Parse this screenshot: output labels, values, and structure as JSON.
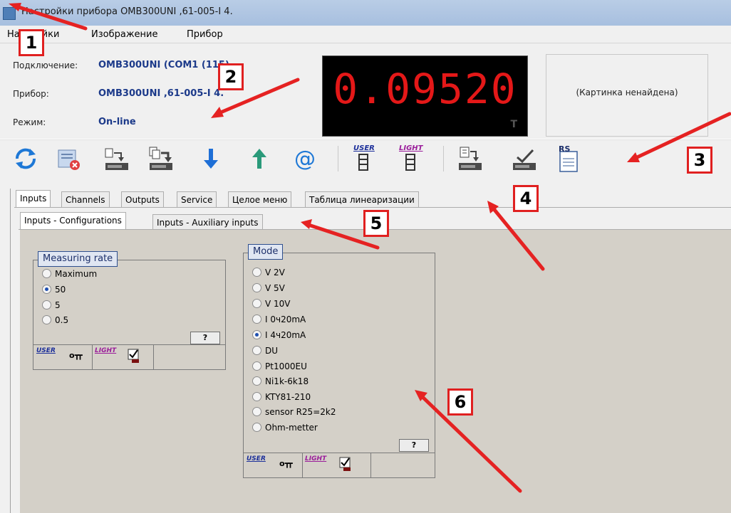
{
  "window": {
    "title": "Настройки прибора OMB300UNI  ,61-005-I 4."
  },
  "menu": {
    "items": [
      "Настройки",
      "Изображение",
      "Прибор"
    ]
  },
  "info": {
    "connection_label": "Подключение:",
    "connection_value": "OMB300UNI (COM1 (115)",
    "device_label": "Прибор:",
    "device_value": "OMB300UNI  ,61-005-I 4.",
    "mode_label": "Режим:",
    "mode_value": "On-line"
  },
  "display": {
    "value": "0.09520",
    "indicator": "T",
    "color": "#e41818"
  },
  "picture": {
    "text": "(Картинка ненайдена)"
  },
  "toolbar": {
    "icons": [
      "refresh-icon",
      "cancel-list-icon",
      "device-read-icon",
      "device-read-all-icon",
      "download-arrow-icon",
      "upload-arrow-icon",
      "email-icon",
      "user-menu-icon",
      "light-menu-icon",
      "device-settings-icon",
      "device-check-icon",
      "rs-file-icon"
    ],
    "user_label": "USER",
    "light_label": "LIGHT",
    "rs_label": "RS"
  },
  "tabs": [
    "Inputs",
    "Channels",
    "Outputs",
    "Service",
    "Целое меню",
    "Таблица линеаризации"
  ],
  "subtabs": [
    "Inputs - Configurations",
    "Inputs - Auxiliary inputs"
  ],
  "measuring_rate": {
    "title": "Measuring rate",
    "options": [
      "Maximum",
      "50",
      "5",
      "0.5"
    ],
    "selected": "50",
    "help": "?"
  },
  "mode": {
    "title": "Mode",
    "options": [
      "V 2V",
      "V 5V",
      "V 10V",
      "I 0ч20mA",
      "I 4ч20mA",
      "DU",
      "Pt1000EU",
      "Ni1k-6k18",
      "KTY81-210",
      "sensor R25=2k2",
      "Ohm-metter"
    ],
    "selected": "I 4ч20mA",
    "help": "?"
  },
  "footer": {
    "user": "USER",
    "light": "LIGHT"
  },
  "annotations": [
    "1",
    "2",
    "3",
    "4",
    "5",
    "6"
  ]
}
